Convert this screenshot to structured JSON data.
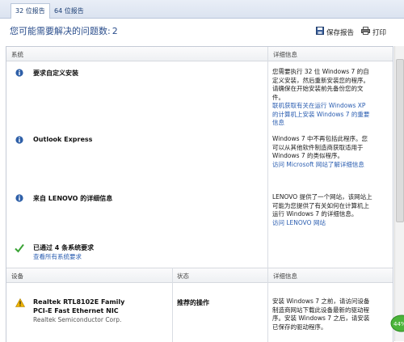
{
  "tabs": [
    {
      "label": "32 位报告",
      "active": true
    },
    {
      "label": "64 位报告",
      "active": false
    }
  ],
  "heading": {
    "label": "您可能需要解决的问题数:",
    "count": "2"
  },
  "toolbar": {
    "save_label": "保存报告",
    "print_label": "打印"
  },
  "system_section": {
    "col_system": "系统",
    "col_details": "详细信息",
    "items": [
      {
        "title": "要求自定义安装",
        "icon": "info-icon",
        "details": "您需要执行 32 位 Windows 7 的自定义安装，然后重新安装您的程序。请确保在开始安装前先备份您的文件。",
        "link": "联机获取有关在运行 Windows XP 的计算机上安装 Windows 7 的重要信息"
      },
      {
        "title": "Outlook Express",
        "icon": "info-icon",
        "details": "Windows 7 中不再包括此程序。您可以从其他软件制造商获取适用于 Windows 7 的类似程序。",
        "link": "访问 Microsoft 网站了解详细信息"
      },
      {
        "title": "来自 LENOVO 的详细信息",
        "icon": "info-icon",
        "details": "LENOVO 提供了一个网站，该网站上可能为您提供了有关如何在计算机上运行 Windows 7 的详细信息。",
        "link": "访问 LENOVO 网站"
      }
    ],
    "passed": {
      "title": "已通过 4 条系统要求",
      "link": "查看所有系统要求"
    }
  },
  "device_section": {
    "col_device": "设备",
    "col_status": "状态",
    "col_details": "详细信息",
    "device": {
      "name_line1": "Realtek RTL8102E Family",
      "name_line2": "PCI-E Fast Ethernet NIC",
      "vendor": "Realtek Semiconductor Corp.",
      "status": "推荐的操作",
      "details": "安装 Windows 7 之前，请访问设备制造商网站下载此设备最新的驱动程序。安装 Windows 7 之后，请安装已保存的驱动程序。"
    }
  },
  "badge_text": "44%",
  "colors": {
    "accent": "#2b4e8c",
    "link": "#2a5db0",
    "warning": "#f0b400",
    "check": "#3aa335"
  }
}
